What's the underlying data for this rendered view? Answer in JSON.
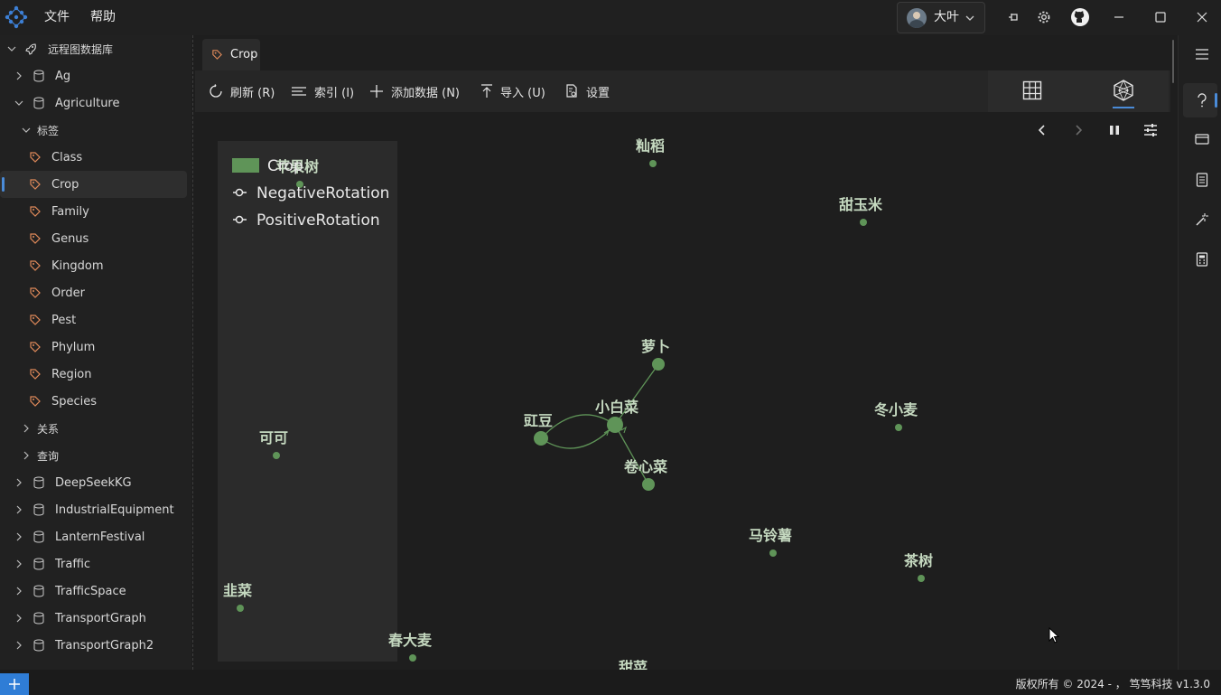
{
  "menu": {
    "file": "文件",
    "help": "帮助"
  },
  "user": {
    "name": "大叶"
  },
  "tree": {
    "root": "远程图数据库",
    "databases_before": [
      "Ag",
      "Agriculture"
    ],
    "tags_group": "标签",
    "tags": [
      "Class",
      "Crop",
      "Family",
      "Genus",
      "Kingdom",
      "Order",
      "Pest",
      "Phylum",
      "Region",
      "Species"
    ],
    "relations_group": "关系",
    "query_group": "查询",
    "databases_after": [
      "DeepSeekKG",
      "IndustrialEquipment",
      "LanternFestival",
      "Traffic",
      "TrafficSpace",
      "TransportGraph",
      "TransportGraph2"
    ]
  },
  "tab": {
    "label": "Crop"
  },
  "toolbar": {
    "refresh": "刷新 (R)",
    "index": "索引 (I)",
    "add_data": "添加数据 (N)",
    "import": "导入 (U)",
    "settings": "设置"
  },
  "legend": {
    "items": [
      {
        "label": "Crop",
        "kind": "node",
        "color": "#5f9458"
      },
      {
        "label": "NegativeRotation",
        "kind": "edge"
      },
      {
        "label": "PositiveRotation",
        "kind": "edge"
      }
    ]
  },
  "graph": {
    "node_color": "#5f9458",
    "label_color": "#c5d9c0",
    "nodes": [
      {
        "label": "苹果树"
      },
      {
        "label": "籼稻"
      },
      {
        "label": "甜玉米"
      },
      {
        "label": "萝卜"
      },
      {
        "label": "小白菜"
      },
      {
        "label": "豇豆"
      },
      {
        "label": "卷心菜"
      },
      {
        "label": "冬小麦"
      },
      {
        "label": "可可"
      },
      {
        "label": "马铃薯"
      },
      {
        "label": "茶树"
      },
      {
        "label": "韭菜"
      },
      {
        "label": "春大麦"
      },
      {
        "label": "甜菜"
      }
    ]
  },
  "status": {
    "copyright": "版权所有 © 2024 - ， 笃笃科技   v1.3.0"
  }
}
